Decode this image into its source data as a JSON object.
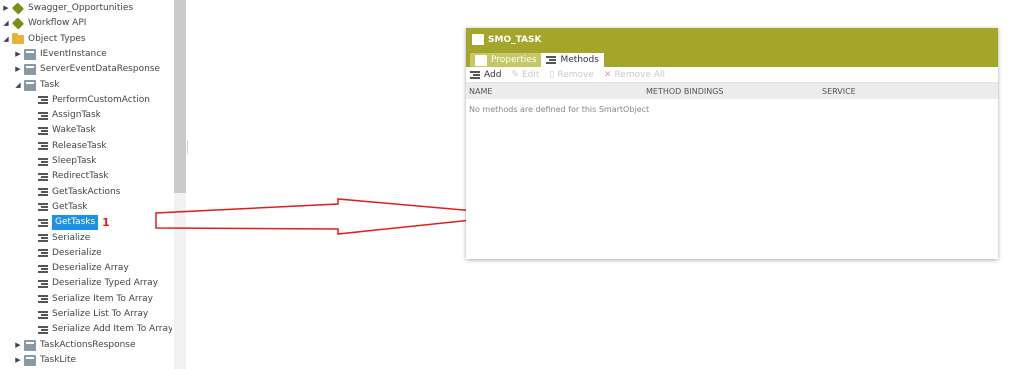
{
  "tree": {
    "items": [
      {
        "label": "Swagger_Opportunities",
        "indent": 0,
        "expander": "▶",
        "icon": "puzzle",
        "selected": false
      },
      {
        "label": "Workflow API",
        "indent": 0,
        "expander": "◢",
        "icon": "puzzle",
        "selected": false
      },
      {
        "label": "Object Types",
        "indent": 1,
        "expander": "◢",
        "icon": "folder",
        "selected": false
      },
      {
        "label": "IEventInstance",
        "indent": 2,
        "expander": "▶",
        "icon": "object",
        "selected": false
      },
      {
        "label": "ServerEventDataResponse",
        "indent": 2,
        "expander": "▶",
        "icon": "object",
        "selected": false
      },
      {
        "label": "Task",
        "indent": 2,
        "expander": "◢",
        "icon": "object",
        "selected": false
      },
      {
        "label": "PerformCustomAction",
        "indent": 3,
        "expander": "",
        "icon": "method",
        "selected": false
      },
      {
        "label": "AssignTask",
        "indent": 3,
        "expander": "",
        "icon": "method",
        "selected": false
      },
      {
        "label": "WakeTask",
        "indent": 3,
        "expander": "",
        "icon": "method",
        "selected": false
      },
      {
        "label": "ReleaseTask",
        "indent": 3,
        "expander": "",
        "icon": "method",
        "selected": false
      },
      {
        "label": "SleepTask",
        "indent": 3,
        "expander": "",
        "icon": "method",
        "selected": false
      },
      {
        "label": "RedirectTask",
        "indent": 3,
        "expander": "",
        "icon": "method",
        "selected": false
      },
      {
        "label": "GetTaskActions",
        "indent": 3,
        "expander": "",
        "icon": "method",
        "selected": false
      },
      {
        "label": "GetTask",
        "indent": 3,
        "expander": "",
        "icon": "method",
        "selected": false
      },
      {
        "label": "GetTasks",
        "indent": 3,
        "expander": "",
        "icon": "method",
        "selected": true,
        "marker": "1"
      },
      {
        "label": "Serialize",
        "indent": 3,
        "expander": "",
        "icon": "method",
        "selected": false
      },
      {
        "label": "Deserialize",
        "indent": 3,
        "expander": "",
        "icon": "method",
        "selected": false
      },
      {
        "label": "Deserialize Array",
        "indent": 3,
        "expander": "",
        "icon": "method",
        "selected": false
      },
      {
        "label": "Deserialize Typed Array",
        "indent": 3,
        "expander": "",
        "icon": "method",
        "selected": false
      },
      {
        "label": "Serialize Item To Array",
        "indent": 3,
        "expander": "",
        "icon": "method",
        "selected": false
      },
      {
        "label": "Serialize List To Array",
        "indent": 3,
        "expander": "",
        "icon": "method",
        "selected": false
      },
      {
        "label": "Serialize Add Item To Array",
        "indent": 3,
        "expander": "",
        "icon": "method",
        "selected": false
      },
      {
        "label": "TaskActionsResponse",
        "indent": 2,
        "expander": "▶",
        "icon": "object",
        "selected": false
      },
      {
        "label": "TaskLite",
        "indent": 2,
        "expander": "▶",
        "icon": "object",
        "selected": false
      }
    ]
  },
  "panel": {
    "title": "SMO_TASK",
    "tabs": [
      {
        "label": "Properties",
        "active": false,
        "icon": "properties-icon"
      },
      {
        "label": "Methods",
        "active": true,
        "icon": "methods-icon"
      }
    ],
    "toolbar": {
      "add": "Add",
      "edit": "Edit",
      "remove": "Remove",
      "remove_all": "Remove All"
    },
    "columns": [
      "NAME",
      "METHOD BINDINGS",
      "SERVICE"
    ],
    "empty_message": "No methods are defined for this SmartObject"
  },
  "colors": {
    "accent": "#a4a52b",
    "selection": "#1e90e6",
    "annotation": "#e11d1d"
  }
}
